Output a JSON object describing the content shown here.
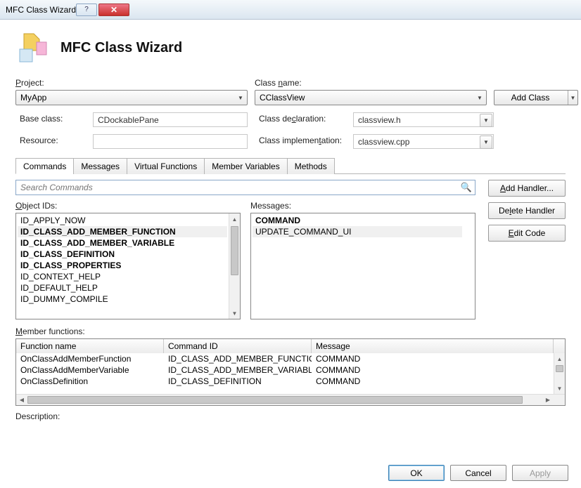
{
  "titlebar": {
    "title": "MFC Class Wizard"
  },
  "header": {
    "heading": "MFC Class Wizard"
  },
  "form": {
    "project_label": "Project:",
    "project_value": "MyApp",
    "classname_label": "Class name:",
    "classname_value": "CClassView",
    "add_class_label": "Add Class",
    "base_class_label": "Base class:",
    "base_class_value": "CDockablePane",
    "resource_label": "Resource:",
    "resource_value": "",
    "decl_label": "Class declaration:",
    "decl_value": "classview.h",
    "impl_label": "Class implementation:",
    "impl_value": "classview.cpp"
  },
  "tabs": {
    "items": [
      {
        "label": "Commands",
        "active": true
      },
      {
        "label": "Messages",
        "active": false
      },
      {
        "label": "Virtual Functions",
        "active": false
      },
      {
        "label": "Member Variables",
        "active": false
      },
      {
        "label": "Methods",
        "active": false
      }
    ]
  },
  "search": {
    "placeholder": "Search Commands"
  },
  "side_buttons": {
    "add_handler": "Add Handler...",
    "delete_handler": "Delete Handler",
    "edit_code": "Edit Code"
  },
  "object_ids": {
    "label": "Object IDs:",
    "items": [
      {
        "text": "ID_APPLY_NOW",
        "bold": false,
        "sel": false
      },
      {
        "text": "ID_CLASS_ADD_MEMBER_FUNCTION",
        "bold": true,
        "sel": true
      },
      {
        "text": "ID_CLASS_ADD_MEMBER_VARIABLE",
        "bold": true,
        "sel": false
      },
      {
        "text": "ID_CLASS_DEFINITION",
        "bold": true,
        "sel": false
      },
      {
        "text": "ID_CLASS_PROPERTIES",
        "bold": true,
        "sel": false
      },
      {
        "text": "ID_CONTEXT_HELP",
        "bold": false,
        "sel": false
      },
      {
        "text": "ID_DEFAULT_HELP",
        "bold": false,
        "sel": false
      },
      {
        "text": "ID_DUMMY_COMPILE",
        "bold": false,
        "sel": false
      }
    ]
  },
  "messages": {
    "label": "Messages:",
    "items": [
      {
        "text": "COMMAND",
        "bold": true,
        "sel": false
      },
      {
        "text": "UPDATE_COMMAND_UI",
        "bold": false,
        "sel": true
      }
    ]
  },
  "member_functions": {
    "label": "Member functions:",
    "columns": {
      "fn": "Function name",
      "cmd": "Command ID",
      "msg": "Message"
    },
    "rows": [
      {
        "fn": "OnClassAddMemberFunction",
        "cmd": "ID_CLASS_ADD_MEMBER_FUNCTION",
        "msg": "COMMAND"
      },
      {
        "fn": "OnClassAddMemberVariable",
        "cmd": "ID_CLASS_ADD_MEMBER_VARIABLE",
        "msg": "COMMAND"
      },
      {
        "fn": "OnClassDefinition",
        "cmd": "ID_CLASS_DEFINITION",
        "msg": "COMMAND"
      }
    ]
  },
  "description_label": "Description:",
  "footer": {
    "ok": "OK",
    "cancel": "Cancel",
    "apply": "Apply"
  }
}
